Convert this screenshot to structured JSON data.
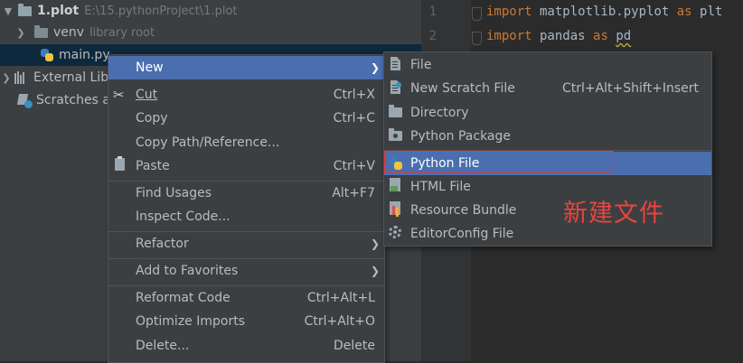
{
  "project_tree": {
    "root": {
      "name": "1.plot",
      "path": "E:\\15.pythonProject\\1.plot"
    },
    "venv": {
      "name": "venv",
      "hint": "library root"
    },
    "file": {
      "name": "main.py"
    },
    "external": {
      "name": "External Libraries"
    },
    "scratches": {
      "name": "Scratches and Consoles"
    }
  },
  "editor": {
    "lines": [
      {
        "no": "1",
        "kw1": "import",
        "mod": " matplotlib.pyplot ",
        "kw2": "as",
        "alias": " plt"
      },
      {
        "no": "2",
        "kw1": "import",
        "mod": " pandas ",
        "kw2": "as",
        "alias": "pd"
      }
    ]
  },
  "context_menu": {
    "new": {
      "label": "New"
    },
    "cut": {
      "label": "Cut",
      "shortcut": "Ctrl+X"
    },
    "copy": {
      "label": "Copy",
      "shortcut": "Ctrl+C"
    },
    "copy_path": {
      "label": "Copy Path/Reference..."
    },
    "paste": {
      "label": "Paste",
      "shortcut": "Ctrl+V"
    },
    "find_usages": {
      "label": "Find Usages",
      "shortcut": "Alt+F7"
    },
    "inspect_code": {
      "label": "Inspect Code..."
    },
    "refactor": {
      "label": "Refactor"
    },
    "add_favorites": {
      "label": "Add to Favorites"
    },
    "reformat_code": {
      "label": "Reformat Code",
      "shortcut": "Ctrl+Alt+L"
    },
    "optimize_imports": {
      "label": "Optimize Imports",
      "shortcut": "Ctrl+Alt+O"
    },
    "delete": {
      "label": "Delete...",
      "shortcut": "Delete"
    }
  },
  "new_submenu": {
    "file": {
      "label": "File"
    },
    "scratch": {
      "label": "New Scratch File",
      "shortcut": "Ctrl+Alt+Shift+Insert"
    },
    "directory": {
      "label": "Directory"
    },
    "package": {
      "label": "Python Package"
    },
    "python_file": {
      "label": "Python File"
    },
    "html_file": {
      "label": "HTML File"
    },
    "resource_bundle": {
      "label": "Resource Bundle"
    },
    "editorconfig": {
      "label": "EditorConfig File"
    }
  },
  "annotation": "新建文件",
  "colors": {
    "selection": "#4b6eaf",
    "annotation": "#e8453c",
    "highlight_border": "#e03c3c"
  }
}
